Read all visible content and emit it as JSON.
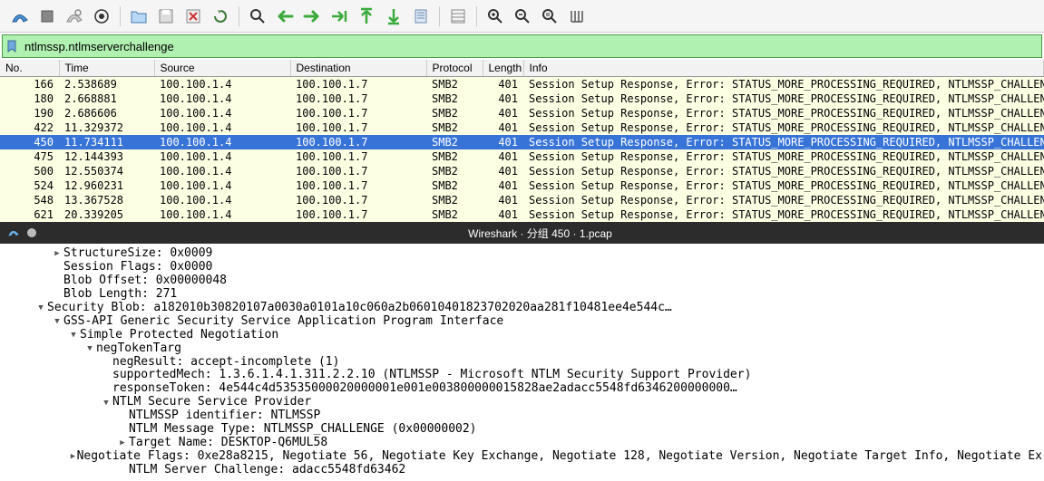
{
  "filter": {
    "value": "ntlmssp.ntlmserverchallenge"
  },
  "columns": {
    "no": "No.",
    "time": "Time",
    "source": "Source",
    "destination": "Destination",
    "protocol": "Protocol",
    "length": "Length",
    "info": "Info"
  },
  "packets": [
    {
      "no": "166",
      "time": "2.538689",
      "src": "100.100.1.4",
      "dst": "100.100.1.7",
      "proto": "SMB2",
      "len": "401",
      "info": "Session Setup Response, Error: STATUS_MORE_PROCESSING_REQUIRED, NTLMSSP_CHALLENGE",
      "selected": false
    },
    {
      "no": "180",
      "time": "2.668881",
      "src": "100.100.1.4",
      "dst": "100.100.1.7",
      "proto": "SMB2",
      "len": "401",
      "info": "Session Setup Response, Error: STATUS_MORE_PROCESSING_REQUIRED, NTLMSSP_CHALLENGE",
      "selected": false
    },
    {
      "no": "190",
      "time": "2.686606",
      "src": "100.100.1.4",
      "dst": "100.100.1.7",
      "proto": "SMB2",
      "len": "401",
      "info": "Session Setup Response, Error: STATUS_MORE_PROCESSING_REQUIRED, NTLMSSP_CHALLENGE",
      "selected": false
    },
    {
      "no": "422",
      "time": "11.329372",
      "src": "100.100.1.4",
      "dst": "100.100.1.7",
      "proto": "SMB2",
      "len": "401",
      "info": "Session Setup Response, Error: STATUS_MORE_PROCESSING_REQUIRED, NTLMSSP_CHALLENGE",
      "selected": false
    },
    {
      "no": "450",
      "time": "11.734111",
      "src": "100.100.1.4",
      "dst": "100.100.1.7",
      "proto": "SMB2",
      "len": "401",
      "info": "Session Setup Response, Error: STATUS_MORE_PROCESSING_REQUIRED, NTLMSSP_CHALLENGE",
      "selected": true
    },
    {
      "no": "475",
      "time": "12.144393",
      "src": "100.100.1.4",
      "dst": "100.100.1.7",
      "proto": "SMB2",
      "len": "401",
      "info": "Session Setup Response, Error: STATUS_MORE_PROCESSING_REQUIRED, NTLMSSP_CHALLENGE",
      "selected": false
    },
    {
      "no": "500",
      "time": "12.550374",
      "src": "100.100.1.4",
      "dst": "100.100.1.7",
      "proto": "SMB2",
      "len": "401",
      "info": "Session Setup Response, Error: STATUS_MORE_PROCESSING_REQUIRED, NTLMSSP_CHALLENGE",
      "selected": false
    },
    {
      "no": "524",
      "time": "12.960231",
      "src": "100.100.1.4",
      "dst": "100.100.1.7",
      "proto": "SMB2",
      "len": "401",
      "info": "Session Setup Response, Error: STATUS_MORE_PROCESSING_REQUIRED, NTLMSSP_CHALLENGE",
      "selected": false
    },
    {
      "no": "548",
      "time": "13.367528",
      "src": "100.100.1.4",
      "dst": "100.100.1.7",
      "proto": "SMB2",
      "len": "401",
      "info": "Session Setup Response, Error: STATUS_MORE_PROCESSING_REQUIRED, NTLMSSP_CHALLENGE",
      "selected": false
    },
    {
      "no": "621",
      "time": "20.339205",
      "src": "100.100.1.4",
      "dst": "100.100.1.7",
      "proto": "SMB2",
      "len": "401",
      "info": "Session Setup Response, Error: STATUS_MORE_PROCESSING_REQUIRED, NTLMSSP_CHALLENGE",
      "selected": false
    }
  ],
  "divider_title": "Wireshark · 分组 450 · 1.pcap",
  "tree": [
    {
      "indent": 3,
      "expand": "closed",
      "text": "StructureSize: 0x0009"
    },
    {
      "indent": 3,
      "expand": "",
      "text": "Session Flags: 0x0000"
    },
    {
      "indent": 3,
      "expand": "",
      "text": "Blob Offset: 0x00000048"
    },
    {
      "indent": 3,
      "expand": "",
      "text": "Blob Length: 271"
    },
    {
      "indent": 2,
      "expand": "open",
      "text": "Security Blob: a182010b30820107a0030a0101a10c060a2b06010401823702020aa281f10481ee4e544c…"
    },
    {
      "indent": 3,
      "expand": "open",
      "text": "GSS-API Generic Security Service Application Program Interface"
    },
    {
      "indent": 4,
      "expand": "open",
      "text": "Simple Protected Negotiation"
    },
    {
      "indent": 5,
      "expand": "open",
      "text": "negTokenTarg"
    },
    {
      "indent": 6,
      "expand": "",
      "text": "negResult: accept-incomplete (1)"
    },
    {
      "indent": 6,
      "expand": "",
      "text": "supportedMech: 1.3.6.1.4.1.311.2.2.10 (NTLMSSP - Microsoft NTLM Security Support Provider)"
    },
    {
      "indent": 6,
      "expand": "",
      "text": "responseToken: 4e544c4d53535000020000001e001e003800000015828ae2adacc5548fd6346200000000…"
    },
    {
      "indent": 6,
      "expand": "open",
      "text": "NTLM Secure Service Provider"
    },
    {
      "indent": 7,
      "expand": "",
      "text": "NTLMSSP identifier: NTLMSSP"
    },
    {
      "indent": 7,
      "expand": "",
      "text": "NTLM Message Type: NTLMSSP_CHALLENGE (0x00000002)"
    },
    {
      "indent": 7,
      "expand": "closed",
      "text": "Target Name: DESKTOP-Q6MUL58"
    },
    {
      "indent": 7,
      "expand": "closed",
      "text": "Negotiate Flags: 0xe28a8215, Negotiate 56, Negotiate Key Exchange, Negotiate 128, Negotiate Version, Negotiate Target Info, Negotiate Ex"
    },
    {
      "indent": 7,
      "expand": "",
      "text": "NTLM Server Challenge: adacc5548fd63462"
    }
  ]
}
